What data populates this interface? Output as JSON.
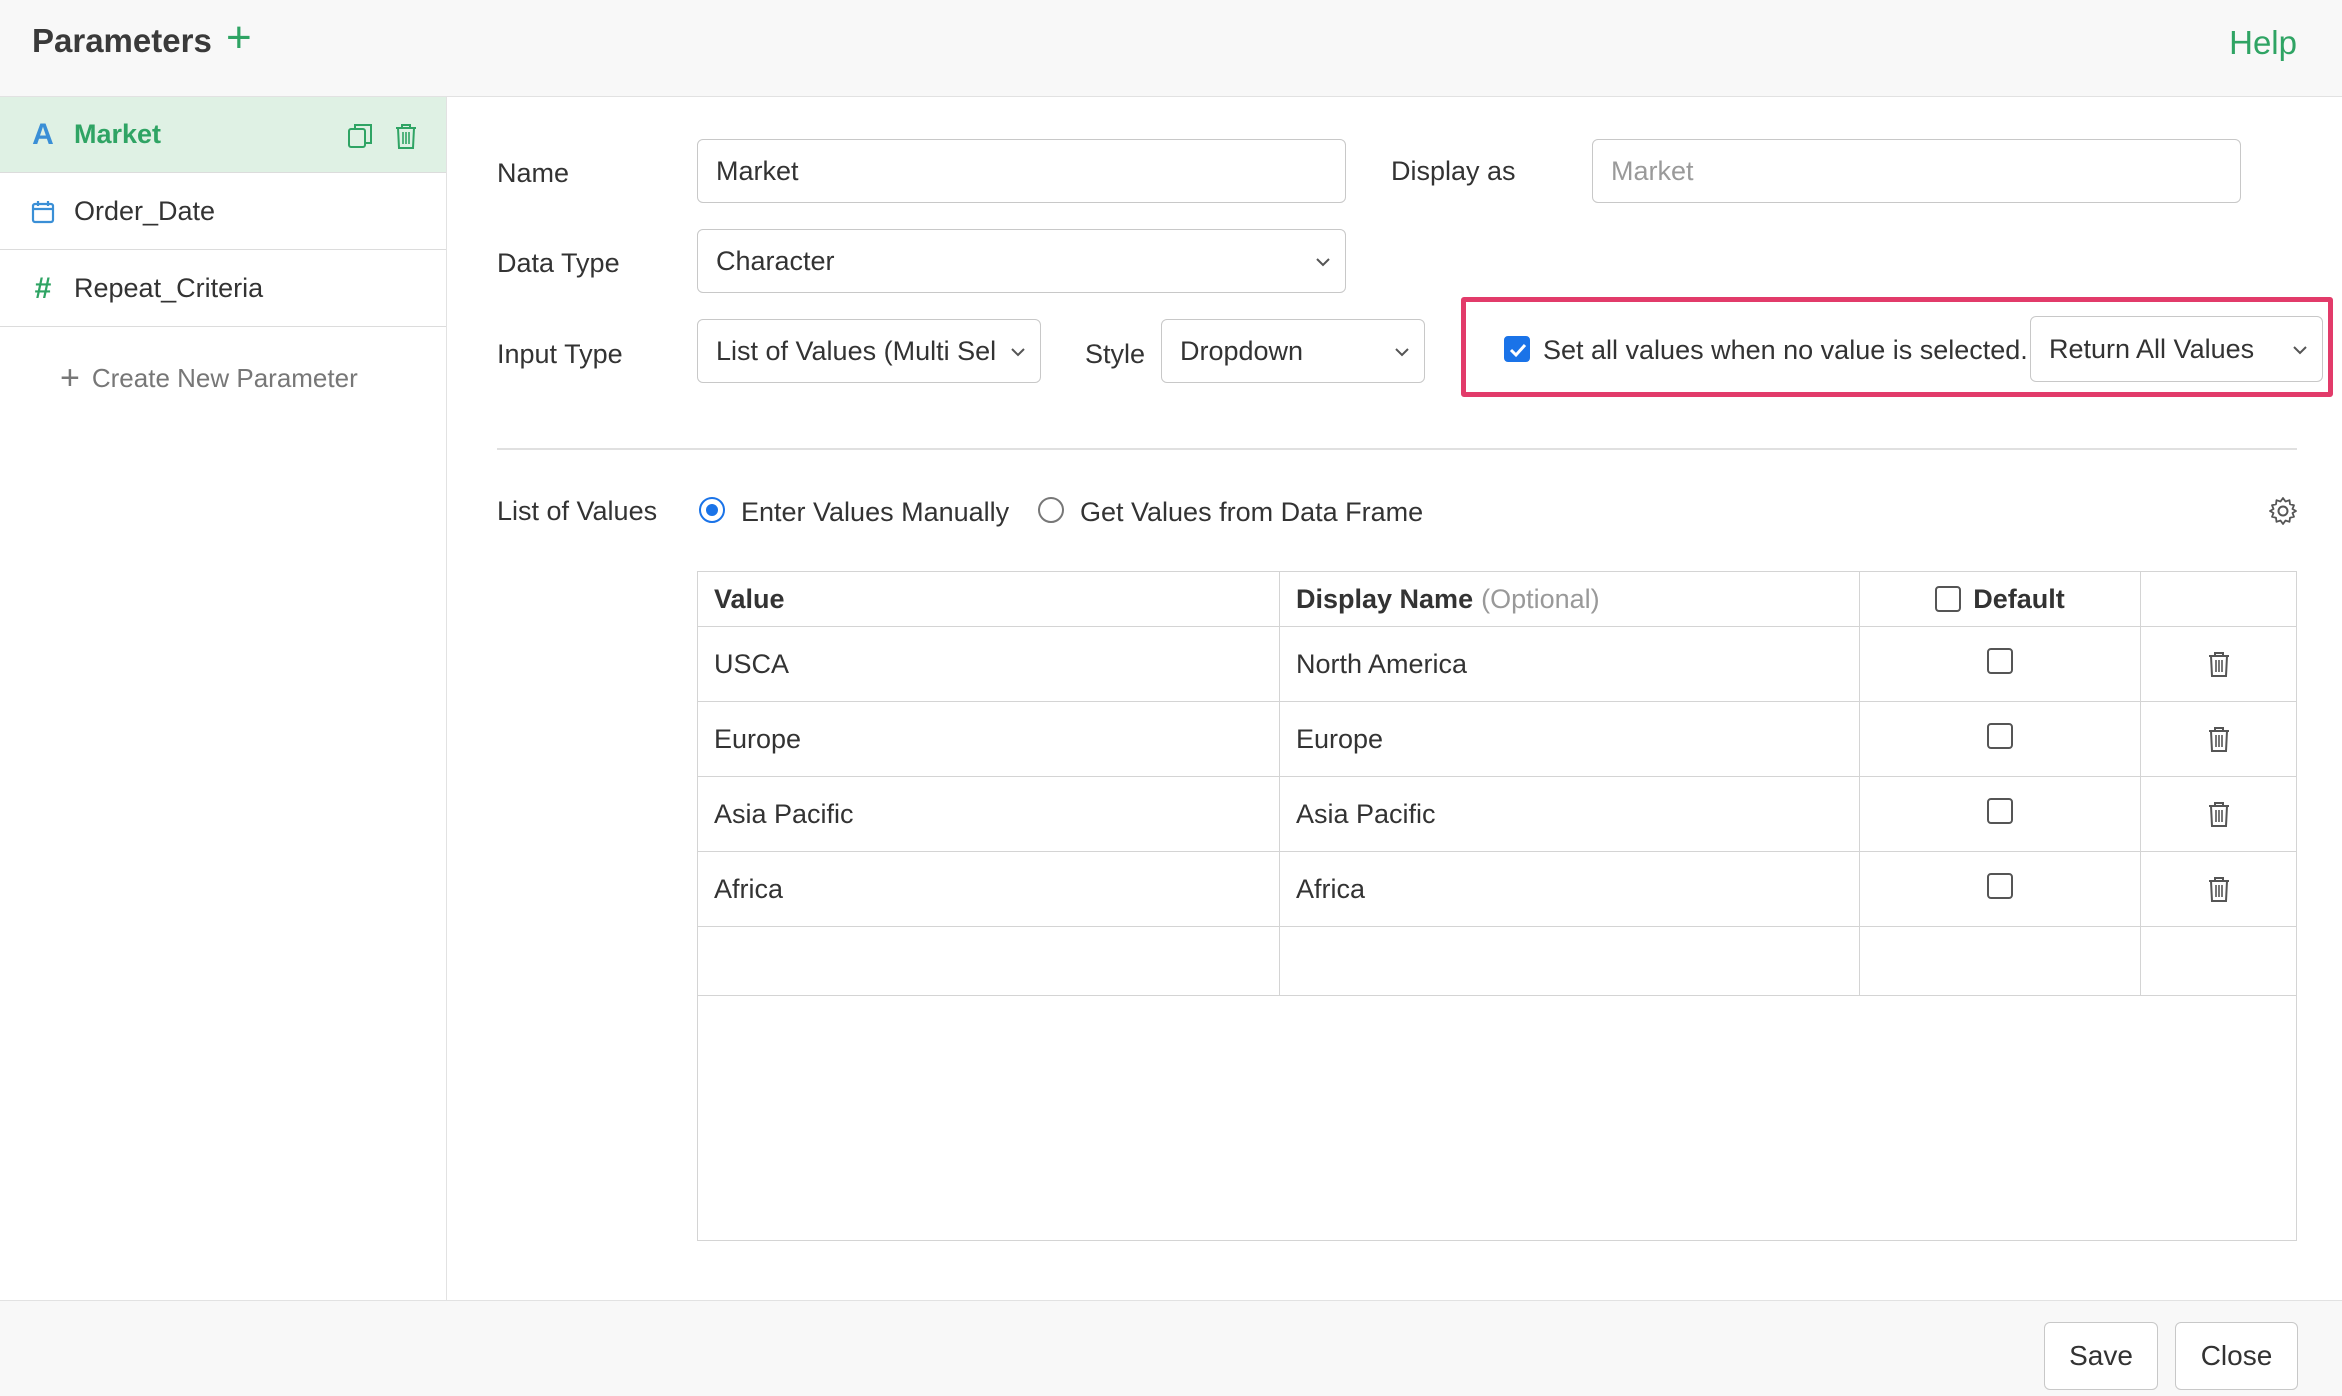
{
  "header": {
    "title": "Parameters",
    "add_icon": "plus-icon",
    "help_label": "Help"
  },
  "sidebar": {
    "items": [
      {
        "icon": "character-type-icon",
        "icon_text": "A",
        "label": "Market",
        "active": true
      },
      {
        "icon": "calendar-icon",
        "label": "Order_Date",
        "active": false
      },
      {
        "icon": "number-type-icon",
        "icon_text": "#",
        "label": "Repeat_Criteria",
        "active": false
      }
    ],
    "create_label": "Create New Parameter"
  },
  "form": {
    "name_label": "Name",
    "name_value": "Market",
    "display_as_label": "Display as",
    "display_as_placeholder": "Market",
    "data_type_label": "Data Type",
    "data_type_value": "Character",
    "input_type_label": "Input Type",
    "input_type_value": "List of Values (Multi Sel",
    "style_label": "Style",
    "style_value": "Dropdown",
    "set_all_label": "Set all values when no value is selected.",
    "set_all_checked": true,
    "return_value": "Return All Values",
    "highlight_color": "#e23b6a"
  },
  "list_of_values": {
    "label": "List of Values",
    "options": [
      {
        "label": "Enter Values Manually",
        "selected": true
      },
      {
        "label": "Get Values from Data Frame",
        "selected": false
      }
    ]
  },
  "table": {
    "headers": {
      "value": "Value",
      "display_name": "Display Name",
      "display_name_hint": "(Optional)",
      "default": "Default"
    },
    "rows": [
      {
        "value": "USCA",
        "display_name": "North America",
        "default": false
      },
      {
        "value": "Europe",
        "display_name": "Europe",
        "default": false
      },
      {
        "value": "Asia Pacific",
        "display_name": "Asia Pacific",
        "default": false
      },
      {
        "value": "Africa",
        "display_name": "Africa",
        "default": false
      }
    ]
  },
  "footer": {
    "save_label": "Save",
    "close_label": "Close"
  },
  "colors": {
    "accent_green": "#2fa464",
    "checkbox_blue": "#1a73e8"
  }
}
